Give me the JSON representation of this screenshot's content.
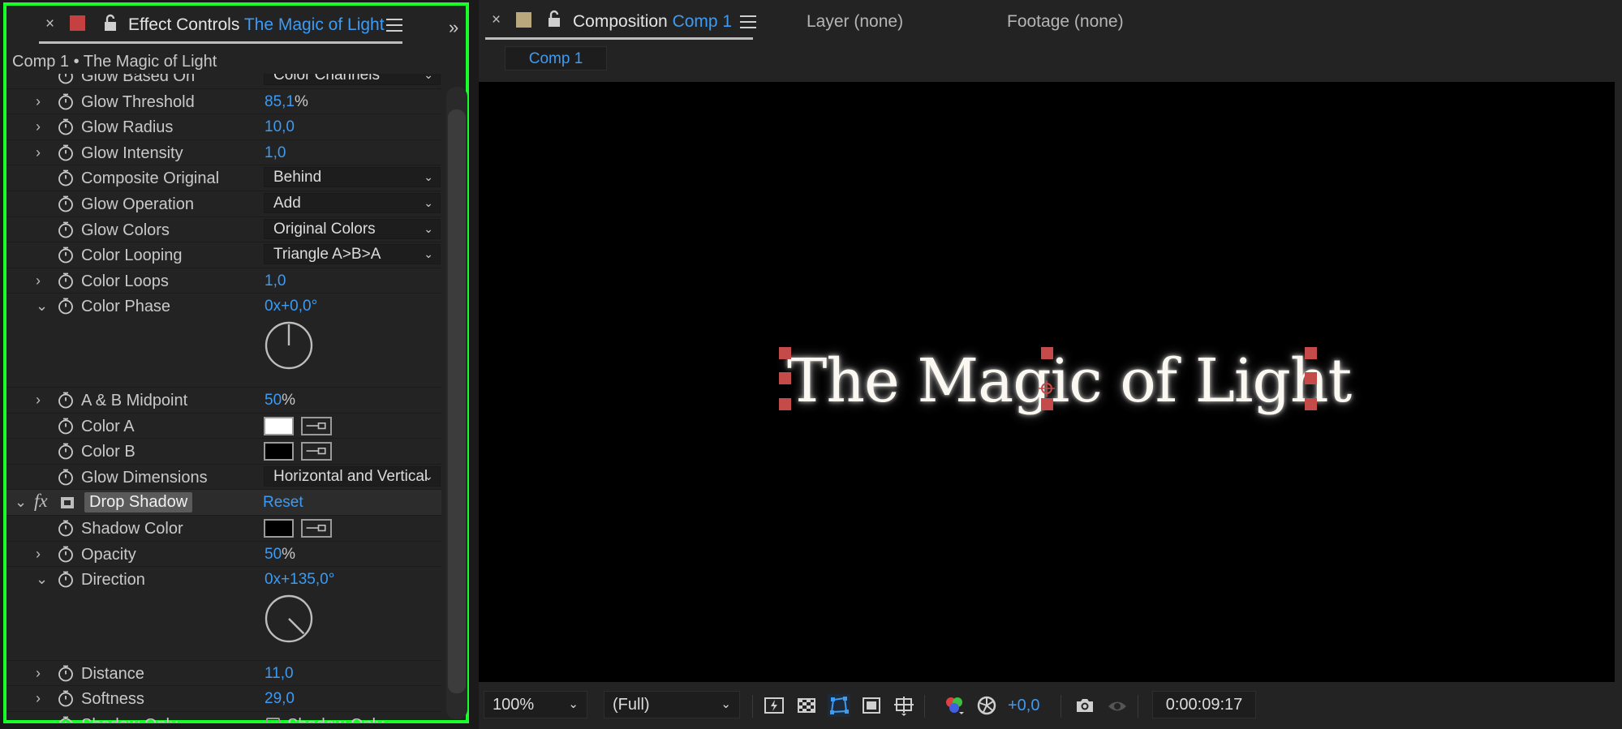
{
  "effect_panel": {
    "close_glyph": "×",
    "label_color": "#c54040",
    "title_prefix": "Effect Controls",
    "title_layer": "The Magic of Light",
    "breadcrumb": "Comp 1 • The Magic of Light",
    "expand_glyph": "»",
    "rows": [
      {
        "name": "Glow Based On",
        "kind": "dropdown",
        "value": "Color Channels",
        "arrow": ""
      },
      {
        "name": "Glow Threshold",
        "kind": "value",
        "value": "85,1",
        "unit": "%",
        "arrow": "›"
      },
      {
        "name": "Glow Radius",
        "kind": "value",
        "value": "10,0",
        "unit": "",
        "arrow": "›"
      },
      {
        "name": "Glow Intensity",
        "kind": "value",
        "value": "1,0",
        "unit": "",
        "arrow": "›"
      },
      {
        "name": "Composite Original",
        "kind": "dropdown",
        "value": "Behind",
        "arrow": ""
      },
      {
        "name": "Glow Operation",
        "kind": "dropdown",
        "value": "Add",
        "arrow": ""
      },
      {
        "name": "Glow Colors",
        "kind": "dropdown",
        "value": "Original Colors",
        "arrow": ""
      },
      {
        "name": "Color Looping",
        "kind": "dropdown",
        "value": "Triangle A>B>A",
        "arrow": ""
      },
      {
        "name": "Color Loops",
        "kind": "value",
        "value": "1,0",
        "unit": "",
        "arrow": "›"
      },
      {
        "name": "Color Phase",
        "kind": "value",
        "value": "0x+0,0°",
        "unit": "",
        "arrow": "⌄"
      },
      {
        "name": "A & B Midpoint",
        "kind": "value",
        "value": "50",
        "unit": "%",
        "arrow": "›"
      },
      {
        "name": "Color A",
        "kind": "color",
        "color": "#ffffff",
        "arrow": ""
      },
      {
        "name": "Color B",
        "kind": "color",
        "color": "#000000",
        "arrow": ""
      },
      {
        "name": "Glow Dimensions",
        "kind": "dropdown",
        "value": "Horizontal and Vertical",
        "arrow": ""
      },
      {
        "name": "Shadow Color",
        "kind": "color",
        "color": "#000000",
        "arrow": ""
      },
      {
        "name": "Opacity",
        "kind": "value",
        "value": "50",
        "unit": "%",
        "arrow": "›"
      },
      {
        "name": "Direction",
        "kind": "value",
        "value": "0x+135,0°",
        "unit": "",
        "arrow": "⌄"
      },
      {
        "name": "Distance",
        "kind": "value",
        "value": "11,0",
        "unit": "",
        "arrow": "›"
      },
      {
        "name": "Softness",
        "kind": "value",
        "value": "29,0",
        "unit": "",
        "arrow": "›"
      },
      {
        "name": "Shadow Only",
        "kind": "checkbox",
        "value": "Shadow Only",
        "arrow": ""
      }
    ],
    "drop_shadow": {
      "fx_glyph": "fx",
      "name": "Drop Shadow",
      "reset": "Reset",
      "arrow": "⌄"
    },
    "color_phase_dial_deg": 0,
    "direction_dial_deg": 135
  },
  "comp_panel": {
    "close_glyph": "×",
    "label_color": "#b9a77e",
    "title_prefix": "Composition",
    "title_comp": "Comp 1",
    "layer_tab": "Layer (none)",
    "footage_tab": "Footage (none)",
    "subtab": "Comp 1",
    "viewer_text": "The Magic of Light",
    "toolbar": {
      "zoom": "100%",
      "resolution": "(Full)",
      "exposure": "+0,0",
      "timecode": "0:00:09:17"
    }
  }
}
